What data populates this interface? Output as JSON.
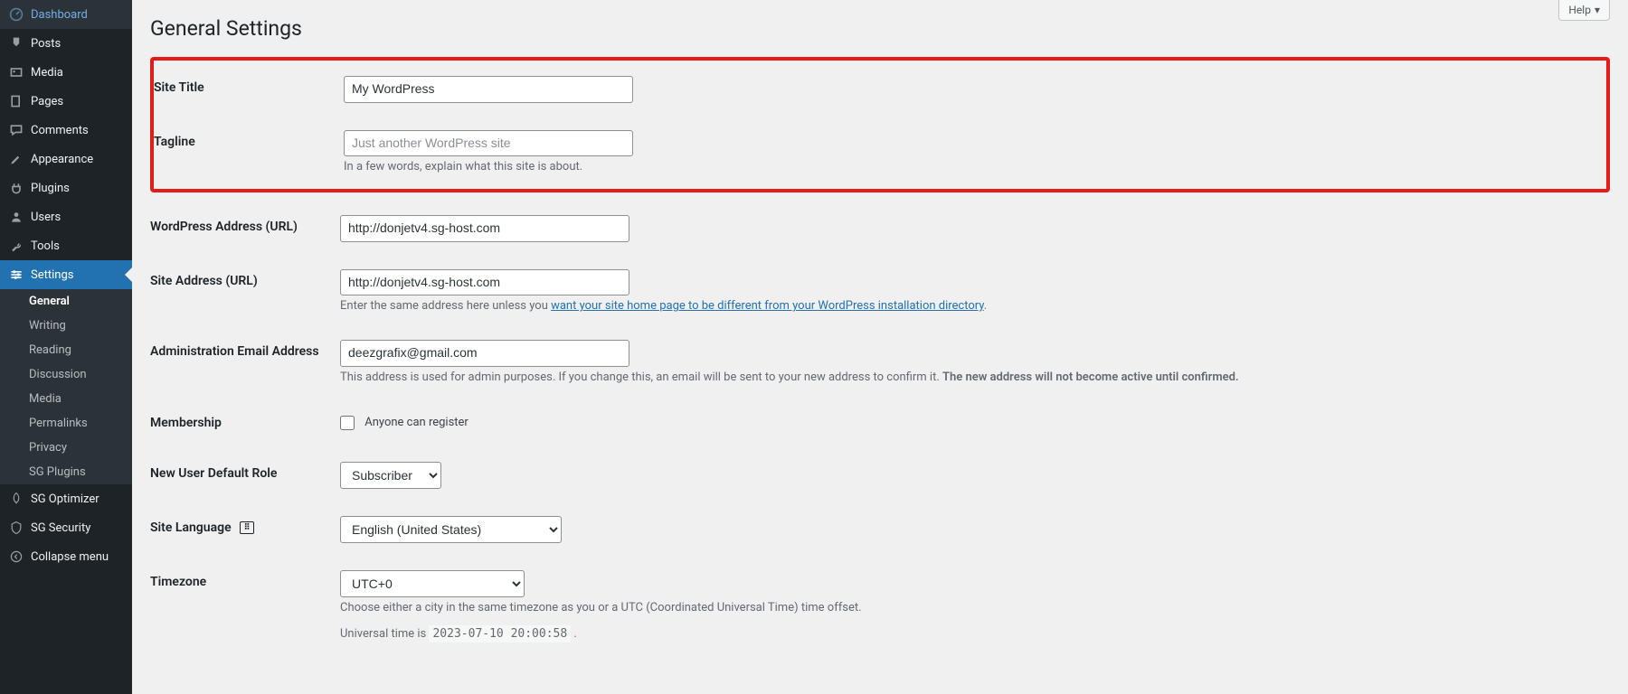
{
  "sidebar": {
    "items": [
      {
        "label": "Dashboard",
        "icon": "dashboard-icon"
      },
      {
        "label": "Posts",
        "icon": "pin-icon"
      },
      {
        "label": "Media",
        "icon": "media-icon"
      },
      {
        "label": "Pages",
        "icon": "page-icon"
      },
      {
        "label": "Comments",
        "icon": "comment-icon"
      },
      {
        "label": "Appearance",
        "icon": "brush-icon"
      },
      {
        "label": "Plugins",
        "icon": "plug-icon"
      },
      {
        "label": "Users",
        "icon": "user-icon"
      },
      {
        "label": "Tools",
        "icon": "wrench-icon"
      },
      {
        "label": "Settings",
        "icon": "sliders-icon"
      }
    ],
    "submenu": [
      {
        "label": "General"
      },
      {
        "label": "Writing"
      },
      {
        "label": "Reading"
      },
      {
        "label": "Discussion"
      },
      {
        "label": "Media"
      },
      {
        "label": "Permalinks"
      },
      {
        "label": "Privacy"
      },
      {
        "label": "SG Plugins"
      }
    ],
    "bottom": [
      {
        "label": "SG Optimizer",
        "icon": "rocket-icon"
      },
      {
        "label": "SG Security",
        "icon": "shield-icon"
      },
      {
        "label": "Collapse menu",
        "icon": "collapse-icon"
      }
    ]
  },
  "header": {
    "help": "Help",
    "title": "General Settings"
  },
  "form": {
    "site_title": {
      "label": "Site Title",
      "value": "My WordPress"
    },
    "tagline": {
      "label": "Tagline",
      "placeholder": "Just another WordPress site",
      "desc": "In a few words, explain what this site is about."
    },
    "wp_address": {
      "label": "WordPress Address (URL)",
      "value": "http://donjetv4.sg-host.com"
    },
    "site_address": {
      "label": "Site Address (URL)",
      "value": "http://donjetv4.sg-host.com",
      "desc_pre": "Enter the same address here unless you ",
      "desc_link": "want your site home page to be different from your WordPress installation directory",
      "desc_post": "."
    },
    "admin_email": {
      "label": "Administration Email Address",
      "value": "deezgrafix@gmail.com",
      "desc_plain": "This address is used for admin purposes. If you change this, an email will be sent to your new address to confirm it. ",
      "desc_strong": "The new address will not become active until confirmed."
    },
    "membership": {
      "label": "Membership",
      "checkbox_label": "Anyone can register"
    },
    "default_role": {
      "label": "New User Default Role",
      "value": "Subscriber"
    },
    "site_language": {
      "label": "Site Language",
      "value": "English (United States)"
    },
    "timezone": {
      "label": "Timezone",
      "value": "UTC+0",
      "desc": "Choose either a city in the same timezone as you or a UTC (Coordinated Universal Time) time offset.",
      "utime_pre": "Universal time is ",
      "utime_code": "2023-07-10 20:00:58",
      "utime_post": " ."
    }
  }
}
